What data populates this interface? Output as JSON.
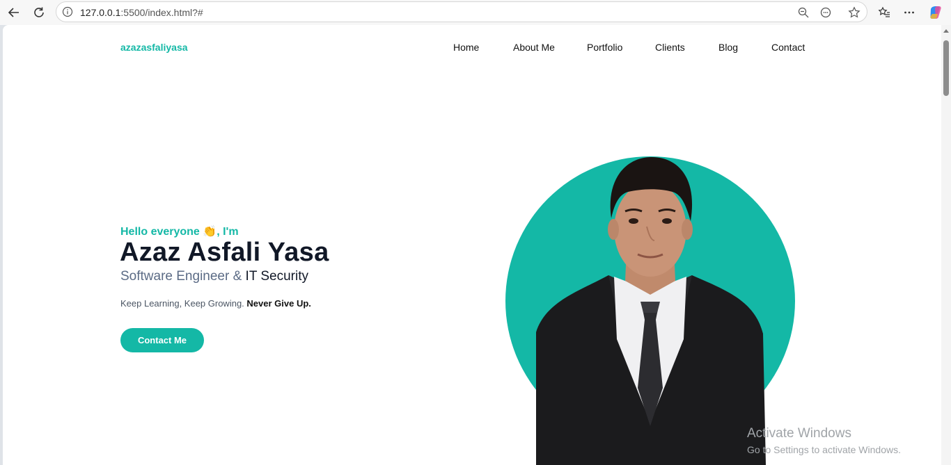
{
  "browser": {
    "url_host": "127.0.0.1",
    "url_rest": ":5500/index.html?#"
  },
  "site": {
    "logo": "azazasfaliyasa",
    "nav": [
      "Home",
      "About Me",
      "Portfolio",
      "Clients",
      "Blog",
      "Contact"
    ],
    "accent_color": "#14b8a6"
  },
  "hero": {
    "greeting": "Hello everyone 👏, I'm",
    "name": "Azaz Asfali Yasa",
    "role_part1": "Software Engineer & ",
    "role_part2": "IT Security",
    "tagline_plain": "Keep Learning, Keep Growing. ",
    "tagline_bold": "Never Give Up.",
    "cta_label": "Contact Me"
  },
  "watermark": {
    "title": "Activate Windows",
    "subtitle": "Go to Settings to activate Windows."
  }
}
